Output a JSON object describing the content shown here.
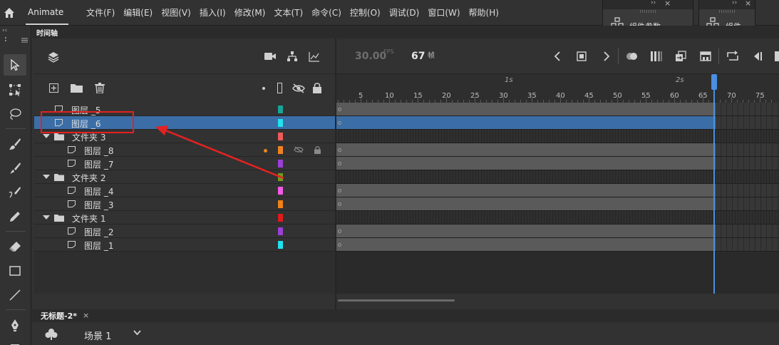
{
  "app": {
    "name": "Animate"
  },
  "menu": [
    "文件(F)",
    "编辑(E)",
    "视图(V)",
    "插入(I)",
    "修改(M)",
    "文本(T)",
    "命令(C)",
    "控制(O)",
    "调试(D)",
    "窗口(W)",
    "帮助(H)"
  ],
  "panels": {
    "component_params": "组件参数",
    "components": "组件"
  },
  "timeline": {
    "tab": "时间轴",
    "fps_value": "30.00",
    "fps_unit": "FPS",
    "frame_value": "67",
    "frame_unit": "帧",
    "ruler_seconds": [
      "1s",
      "2s"
    ],
    "ruler_numbers": [
      "5",
      "10",
      "15",
      "20",
      "25",
      "30",
      "35",
      "40",
      "45",
      "50",
      "55",
      "60",
      "65",
      "70",
      "75"
    ]
  },
  "layers": [
    {
      "name": "图层 _5",
      "kind": "layer",
      "indent": 0,
      "color": "#1aa39a",
      "selected": false
    },
    {
      "name": "图层 _6",
      "kind": "layer",
      "indent": 0,
      "color": "#22e2f0",
      "selected": true
    },
    {
      "name": "文件夹 3",
      "kind": "folder",
      "indent": 0,
      "color": "#f05a5a",
      "selected": false
    },
    {
      "name": "图层 _8",
      "kind": "layer",
      "indent": 1,
      "color": "#f0821e",
      "selected": false,
      "active_dot": true,
      "hidden_icon": true,
      "lock_icon": true
    },
    {
      "name": "图层 _7",
      "kind": "layer",
      "indent": 1,
      "color": "#9b3fd6",
      "selected": false
    },
    {
      "name": "文件夹 2",
      "kind": "folder",
      "indent": 0,
      "color": "#6f9b1e",
      "selected": false
    },
    {
      "name": "图层 _4",
      "kind": "layer",
      "indent": 1,
      "color": "#f25ae6",
      "selected": false
    },
    {
      "name": "图层 _3",
      "kind": "layer",
      "indent": 1,
      "color": "#f08218",
      "selected": false
    },
    {
      "name": "文件夹 1",
      "kind": "folder",
      "indent": 0,
      "color": "#e01a1a",
      "selected": false
    },
    {
      "name": "图层 _2",
      "kind": "layer",
      "indent": 1,
      "color": "#9b3fd6",
      "selected": false
    },
    {
      "name": "图层 _1",
      "kind": "layer",
      "indent": 1,
      "color": "#22e2f0",
      "selected": false
    }
  ],
  "document": {
    "tab": "无标题-2*",
    "close": "×",
    "scene": "场景 1"
  },
  "annotation": {
    "color": "#e32222",
    "target": "图层 _6"
  }
}
